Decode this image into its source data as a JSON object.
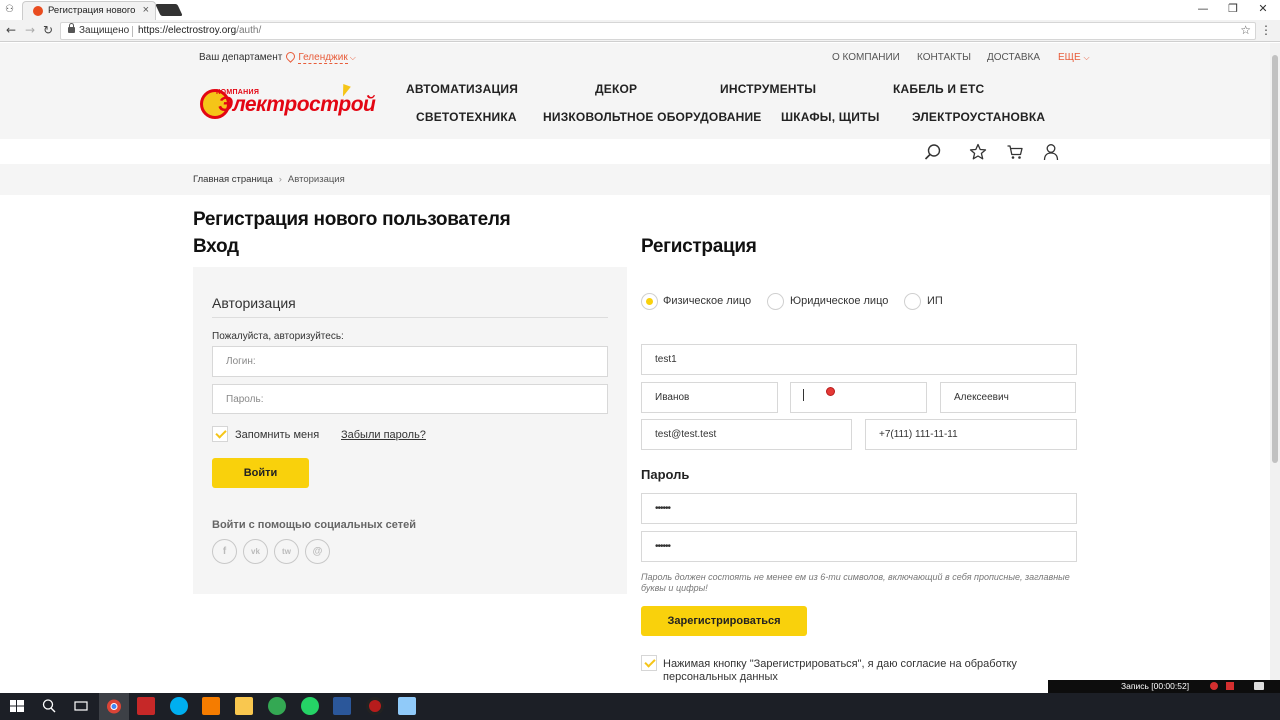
{
  "browser": {
    "tab_title": "Регистрация нового по...",
    "secure_label": "Защищено",
    "url_host": "https://electrostroy.org",
    "url_path": "/auth/"
  },
  "header": {
    "dept_label": "Ваш департамент",
    "dept_city": "Геленджик",
    "top_links": [
      "О компании",
      "Контакты",
      "Доставка"
    ],
    "more_label": "Еще",
    "logo_small": "КОМПАНИЯ",
    "logo_name": "Электрострой",
    "categories_row1": [
      "Автоматизация",
      "Декор",
      "Инструменты",
      "Кабель и ЕТС"
    ],
    "categories_row2": [
      "Светотехника",
      "Низковольтное оборудование",
      "Шкафы, щиты",
      "Электроустановка"
    ]
  },
  "breadcrumb": {
    "home": "Главная страница",
    "current": "Авторизация"
  },
  "page_title": "Регистрация нового пользователя",
  "login": {
    "heading": "Вход",
    "panel_title": "Авторизация",
    "prompt": "Пожалуйста, авторизуйтесь:",
    "login_placeholder": "Логин:",
    "password_placeholder": "Пароль:",
    "remember_label": "Запомнить меня",
    "forgot_label": "Забыли пароль?",
    "submit_label": "Войти",
    "social_title": "Войти с помощью социальных сетей",
    "social": [
      "f",
      "vk",
      "tw",
      "@"
    ]
  },
  "registration": {
    "heading": "Регистрация",
    "types": [
      "Физическое лицо",
      "Юридическое лицо",
      "ИП"
    ],
    "selected_type": "Физическое лицо",
    "login_value": "test1",
    "last_name_value": "Иванов",
    "first_name_value": "",
    "middle_name_value": "Алексеевич",
    "email_value": "test@test.test",
    "phone_value": "+7(111) 111-11-11",
    "password_heading": "Пароль",
    "password_value": "••••••",
    "password_confirm_value": "••••••",
    "password_hint": "Пароль должен состоять не менее ем из 6-ти символов, включающий в себя прописные, заглавные буквы и цифры!",
    "submit_label": "Зарегистрироваться",
    "consent_text": "Нажимая кнопку \"Зарегистрироваться\", я даю согласие на обработку персональных данных"
  },
  "system": {
    "recording_label": "Запись [00:00:52]"
  },
  "colors": {
    "accent_yellow": "#f9d10c",
    "brand_red": "#e30613",
    "link_orange": "#e85c3a",
    "header_bg": "#f5f5f5"
  }
}
